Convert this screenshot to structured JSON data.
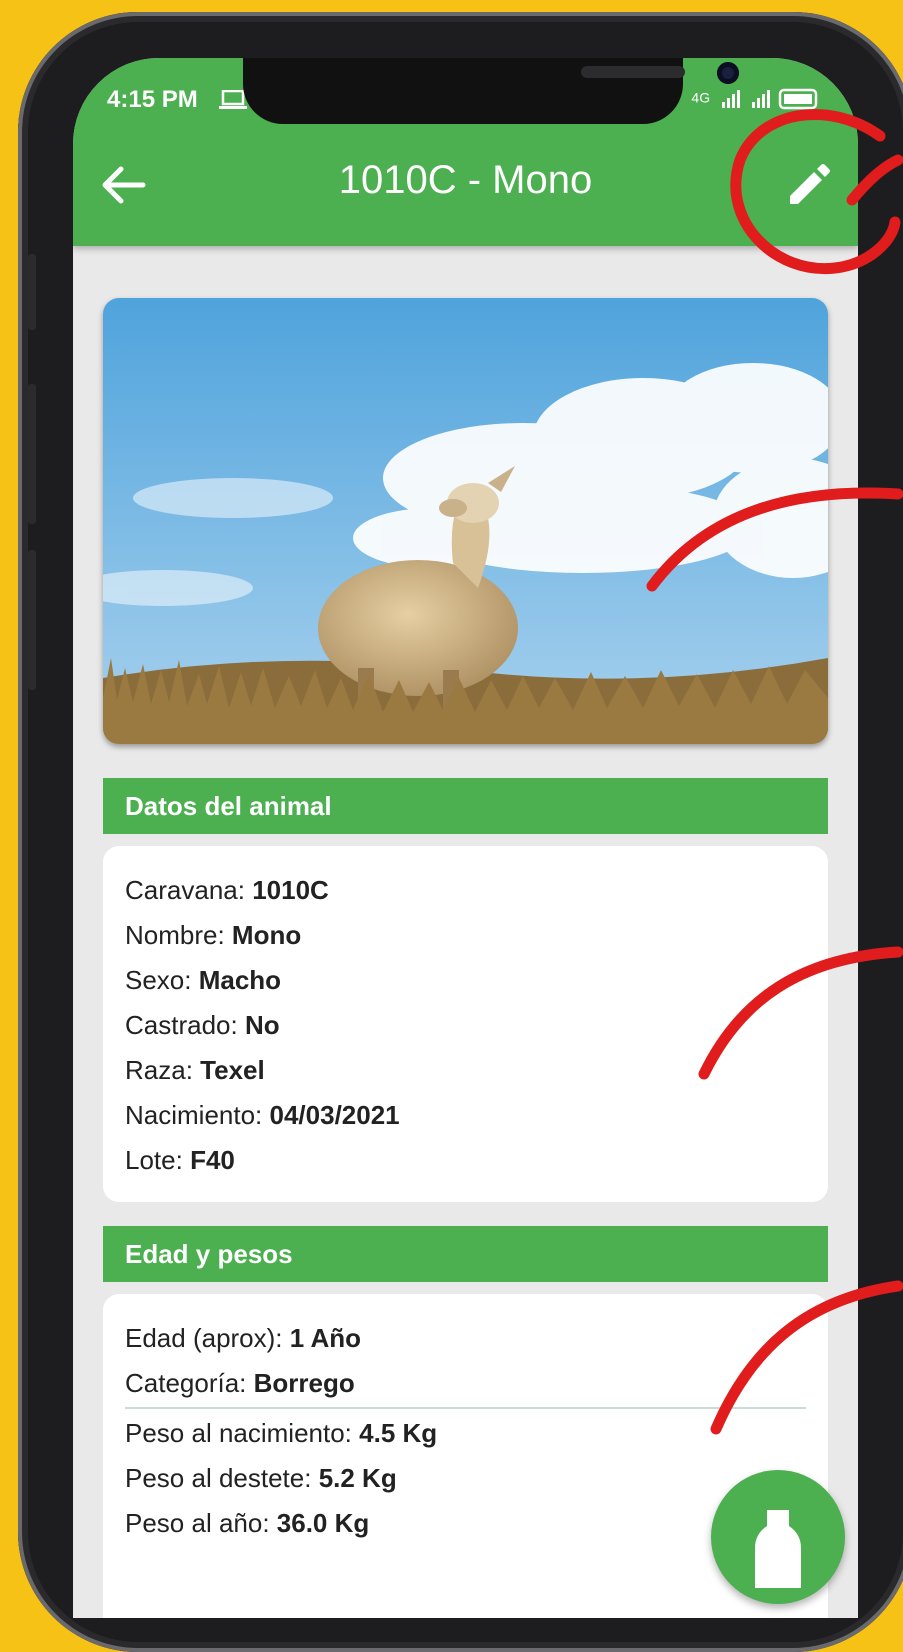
{
  "status_bar": {
    "time": "4:15 PM",
    "network": "4G"
  },
  "app_bar": {
    "title": "1010C - Mono"
  },
  "photo": {
    "alt": "Oveja en el campo"
  },
  "datos": {
    "header": "Datos del animal",
    "rows": [
      {
        "label": "Caravana: ",
        "value": "1010C"
      },
      {
        "label": "Nombre: ",
        "value": "Mono"
      },
      {
        "label": "Sexo: ",
        "value": "Macho"
      },
      {
        "label": "Castrado: ",
        "value": "No"
      },
      {
        "label": "Raza: ",
        "value": "Texel"
      },
      {
        "label": "Nacimiento: ",
        "value": "04/03/2021"
      },
      {
        "label": "Lote: ",
        "value": "F40"
      }
    ]
  },
  "edad": {
    "header": "Edad y pesos",
    "rows_top": [
      {
        "label": "Edad (aprox): ",
        "value": "1 Año"
      },
      {
        "label": "Categoría: ",
        "value": "Borrego"
      }
    ],
    "rows_bottom": [
      {
        "label": "Peso al nacimiento: ",
        "value": "4.5 Kg"
      },
      {
        "label": "Peso al destete: ",
        "value": "5.2 Kg"
      },
      {
        "label": "Peso al año: ",
        "value": "36.0 Kg"
      }
    ]
  },
  "colors": {
    "primary": "#4caf50",
    "background": "#f6c216",
    "annotation": "#e01c1c"
  },
  "icons": {
    "back": "arrow-left-icon",
    "edit": "pencil-icon",
    "fab": "bottle-icon"
  }
}
